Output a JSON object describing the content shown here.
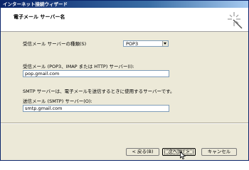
{
  "window": {
    "title": "インターネット接続ウィザード"
  },
  "header": {
    "title": "電子メール サーバー名",
    "icon": "wizard-wand-icon"
  },
  "form": {
    "incoming_type_label": "受信メール サーバーの種類(S)",
    "incoming_type_value": "POP3",
    "incoming_server_label": "受信メール (POP3、IMAP または HTTP) サーバー(I):",
    "incoming_server_value": "pop.gmail.com",
    "smtp_note": "SMTP サーバーは、電子メールを送信するときに使用するサーバーです。",
    "outgoing_server_label": "送信メール (SMTP) サーバー(O):",
    "outgoing_server_value": "smtp.gmail.com"
  },
  "buttons": {
    "back": "< 戻る(B)",
    "next": "次へ(N) >",
    "cancel": "キャンセル"
  },
  "colors": {
    "title_bar": "#0a246a",
    "dialog_bg": "#ece9d8",
    "field_border": "#7f9db9"
  }
}
